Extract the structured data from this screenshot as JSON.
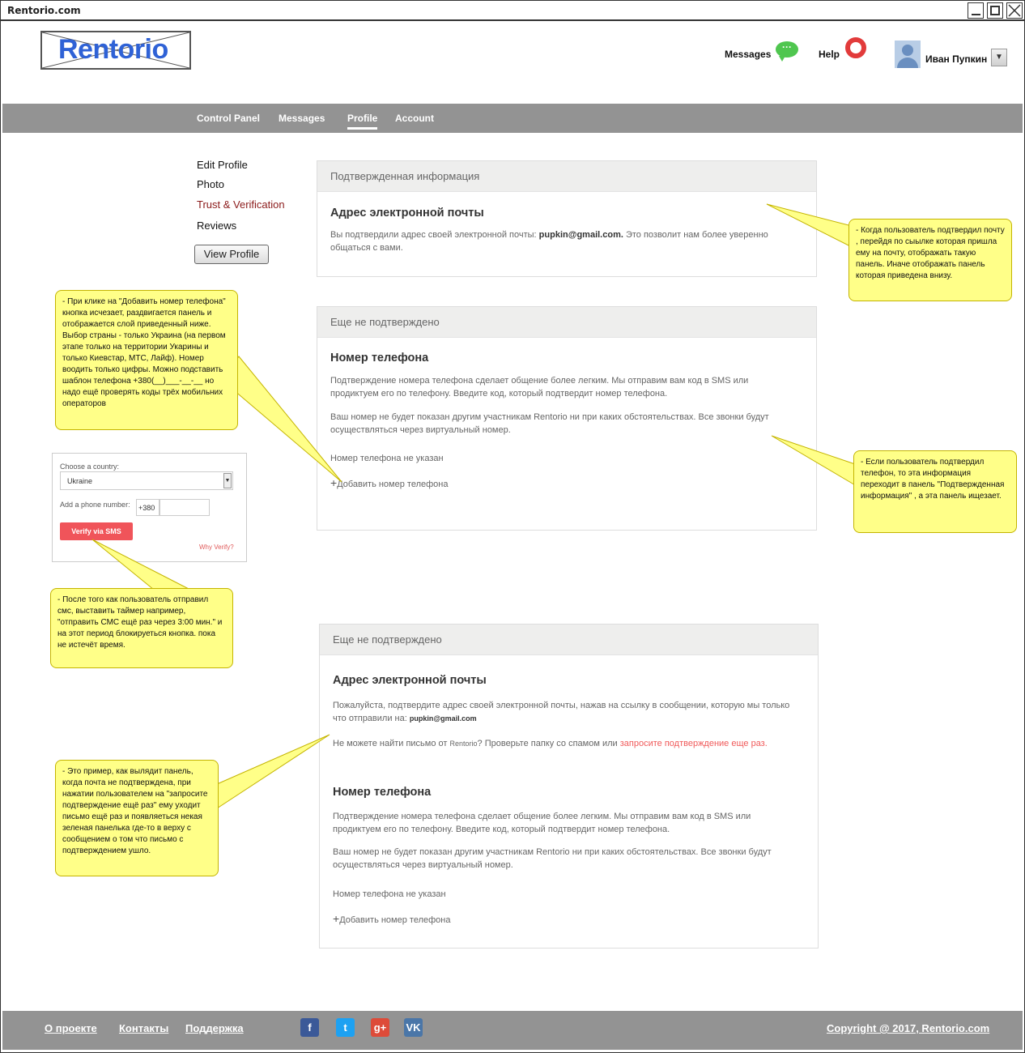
{
  "window": {
    "title": "Rentorio.com"
  },
  "header": {
    "logo": "Rentorio",
    "messages_label": "Messages",
    "messages_icon": "speech-bubble-icon",
    "help_label": "Help",
    "help_icon": "lifebuoy-icon",
    "user_name": "Иван Пупкин"
  },
  "nav": {
    "items": [
      "Control Panel",
      "Messages",
      "Profile",
      "Account"
    ],
    "active": "Profile"
  },
  "sidebar": {
    "items": [
      "Edit Profile",
      "Photo",
      "Trust & Verification",
      "Reviews"
    ],
    "active_color": "#8b1a1a",
    "view_profile": "View Profile"
  },
  "panel_verified": {
    "header": "Подтвержденная информация",
    "title": "Адрес электронной почты",
    "text_before": "Вы подтвердили адрес своей электронной почты: ",
    "email": "pupkin@gmail.com.",
    "text_after": " Это позволит нам более уверенно общаться с вами."
  },
  "panel_unverified": {
    "header": "Еще не подтверждено",
    "title": "Номер телефона",
    "text1": "Подтверждение номера телефона сделает общение более легким. Мы отправим вам код в SMS или продиктуем его по телефону. Введите код, который подтвердит номер телефона.",
    "text2": "Ваш номер не будет показан другим участникам Rentorio ни при каких обстоятельствах. Все звонки будут осуществляться через виртуальный номер.",
    "status": "Номер телефона не указан",
    "add_phone": "Добавить номер телефона"
  },
  "panel_example": {
    "header": "Еще не подтверждено",
    "email_title": "Адрес электронной почты",
    "email_text": "Пожалуйста, подтвердите адрес своей электронной почты, нажав на ссылку в сообщении, которую мы только что отправили на: ",
    "email": "pupkin@gmail.com",
    "cant_find_before": "Не можете найти письмо от ",
    "cant_find_brand": "Rentorio",
    "cant_find_after": "? Проверьте папку со спамом или ",
    "resend_link": "запросите подтверждение еще раз.",
    "phone_title": "Номер телефона",
    "phone_text1": "Подтверждение номера телефона сделает общение более легким. Мы отправим вам код в SMS или продиктуем его по телефону. Введите код, который подтвердит номер телефона.",
    "phone_text2": "Ваш номер не будет показан другим участникам Rentorio ни при каких обстоятельствах. Все звонки будут осуществляться через виртуальный номер.",
    "phone_status": "Номер телефона не указан",
    "add_phone": "Добавить номер телефона"
  },
  "verify_widget": {
    "country_label": "Choose a country:",
    "country_value": "Ukraine",
    "phone_label": "Add a phone number:",
    "prefix": "+380",
    "button": "Verify via SMS",
    "why": "Why Verify?"
  },
  "callouts": {
    "c1": "- При клике на \"Добавить номер телефона\" кнопка исчезает, раздвигается панель и отображается слой приведенный ниже. Выбор страны - только Украина (на первом этапе только на территории Укарины и только Киевстар, МТС, Лайф). Номер воодить только цифры. Можно подставить шаблон телефона +380(__)___-__-__ но надо ещё проверять коды трёх мобильних операторов",
    "c2": "- Когда пользователь подтвердил почту , перейдя по сыылке которая пришла ему на почту, отображать такую панель. Иначе отображать панель которая приведена внизу.",
    "c3": "- Если пользователь подтвердил телефон, то эта информация переходит в панель \"Подтвержденная информация\" , а эта панель ищезает.",
    "c4": "- После того как пользователь отправил смс, выставить таймер например, \"отправить СМС ещё раз через 3:00 мин.\" и на этот период блокируеться кнопка. пока не истечёт время.",
    "c5": "- Это пример, как вылядит панель, когда почта не подтверждена, при нажатии пользователем на \"запросите подтверждение ещё раз\" ему уходит письмо ещё раз и появляеться некая зеленая панелька где-то в верху с сообщением о том что письмо с подтверждением ушло."
  },
  "footer": {
    "links": [
      "О проекте",
      "Контакты",
      "Поддержка"
    ],
    "social": [
      {
        "icon": "facebook-icon",
        "glyph": "f",
        "color": "#3b5998"
      },
      {
        "icon": "twitter-icon",
        "glyph": "t",
        "color": "#1da1f2"
      },
      {
        "icon": "google-plus-icon",
        "glyph": "g+",
        "color": "#dd4b39"
      },
      {
        "icon": "vk-icon",
        "glyph": "VK",
        "color": "#4a76a8"
      }
    ],
    "copyright": "Copyright @ 2017, Rentorio.com"
  }
}
